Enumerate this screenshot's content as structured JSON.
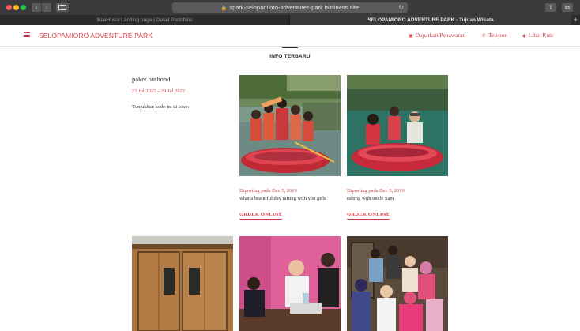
{
  "browser": {
    "url": "spark-selopamioro-adventures-park.business.site",
    "tabs": [
      {
        "label": "IkaaHusni Landing page | Detail Portofolio"
      },
      {
        "label": "SELOPAMIORO ADVENTURE PARK - Tujuan Wisata"
      }
    ]
  },
  "header": {
    "brand": "SELOPAMIORO ADVENTURE PARK",
    "nav": {
      "offer": "Dapatkan Penawaran",
      "phone": "Telepon",
      "route": "Lihat Rute"
    }
  },
  "section": {
    "title": "INFO TERBARU"
  },
  "info": {
    "title": "paket outbond",
    "dates": "22 Jul 2022 – 29 Jul 2022",
    "code_text": "Tunjukkan kode ini di toko:"
  },
  "posts": [
    {
      "posted": "Diposting pada Dec 5, 2019",
      "caption": "what a beautiful day rafting with you girls",
      "order": "ORDER ONLINE"
    },
    {
      "posted": "Diposting pada Dec 5, 2019",
      "caption": "rafting with uncle Sam",
      "order": "ORDER ONLINE"
    }
  ],
  "colors": {
    "accent": "#d0424a",
    "chrome": "#3a3a3c"
  }
}
